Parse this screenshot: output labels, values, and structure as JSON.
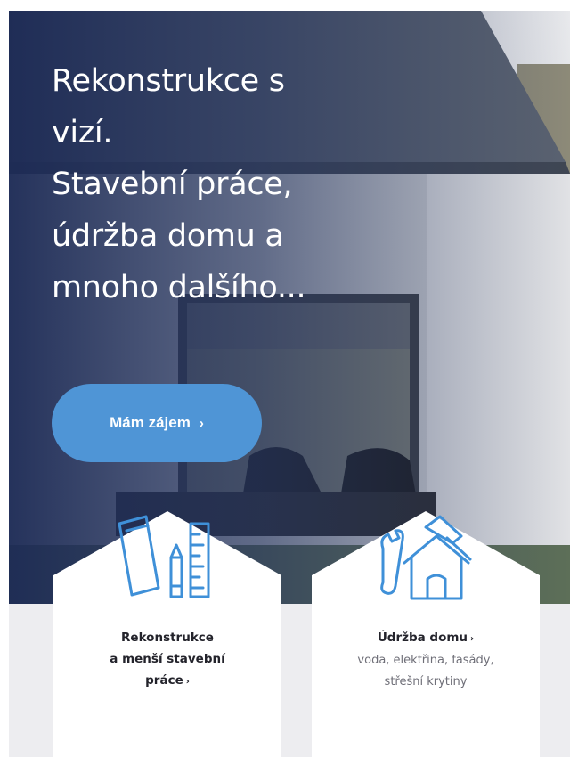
{
  "hero": {
    "headline_lines": [
      "Rekonstrukce s",
      "vizí.",
      "Stavební práce,",
      "údržba domu a",
      "mnoho dalšího..."
    ],
    "cta_label": "Mám zájem",
    "cta_chevron": "›"
  },
  "services": [
    {
      "icon": "tools-ruler-icon",
      "title_lines": [
        "Rekonstrukce",
        "a menší stavební",
        "práce"
      ],
      "chevron": "›",
      "subtitle_lines": []
    },
    {
      "icon": "house-wrench-icon",
      "title_lines": [
        "Údržba domu"
      ],
      "chevron": "›",
      "subtitle_lines": [
        "voda, elektřina, fasády,",
        "střešní krytiny"
      ]
    }
  ],
  "colors": {
    "primary": "#4f95d6",
    "icon": "#3f90d8",
    "hero_overlay": "#1f2f5a",
    "card_bg": "#ffffff",
    "lower_bg": "#ededf0"
  }
}
